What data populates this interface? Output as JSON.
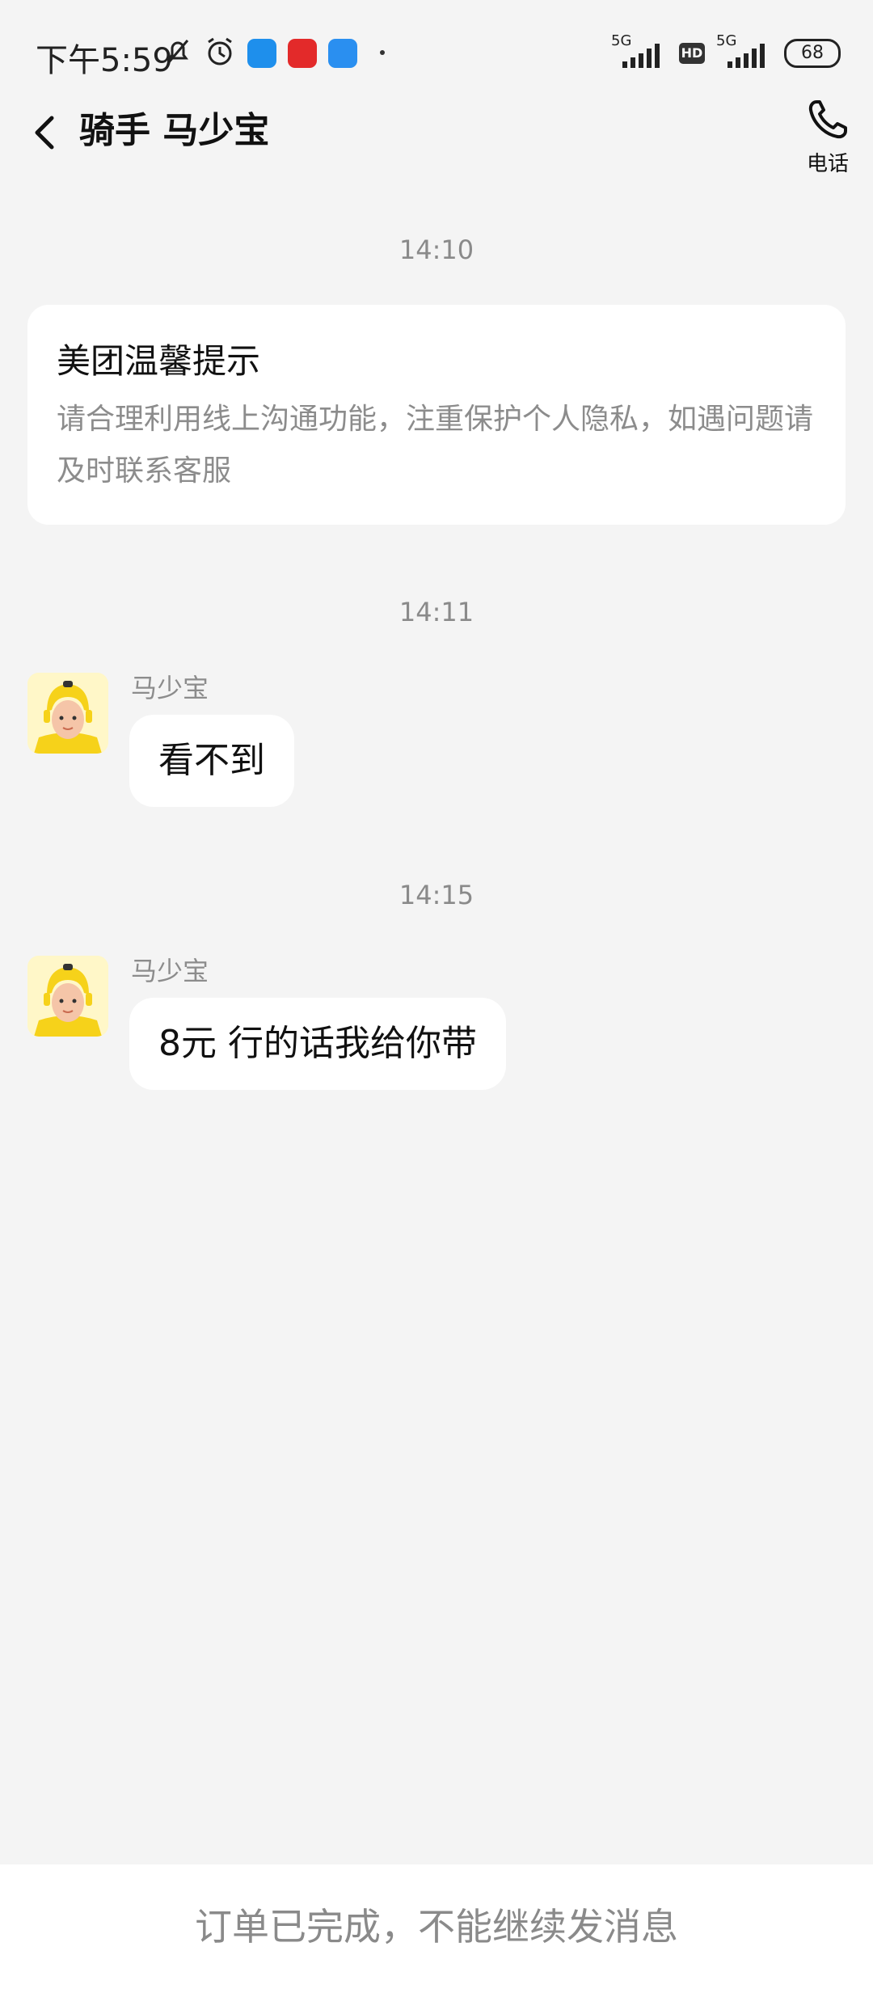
{
  "status_bar": {
    "time": "下午5:59",
    "network_1": "5G",
    "network_2": "5G",
    "hd_label": "HD",
    "battery": "68"
  },
  "header": {
    "title": "骑手 马少宝",
    "phone_label": "电话"
  },
  "messages": {
    "time_1": "14:10",
    "notice_title": "美团温馨提示",
    "notice_body": "请合理利用线上沟通功能，注重保护个人隐私，如遇问题请及时联系客服",
    "time_2": "14:11",
    "msg1_sender": "马少宝",
    "msg1_text": "看不到",
    "time_3": "14:15",
    "msg2_sender": "马少宝",
    "msg2_text": "8元 行的话我给你带"
  },
  "footer": {
    "status_text": "订单已完成，不能继续发消息"
  },
  "colors": {
    "background": "#f4f4f4",
    "bubble": "#ffffff",
    "avatar_helmet": "#f6d21a",
    "muted_text": "#8a8a8a"
  }
}
